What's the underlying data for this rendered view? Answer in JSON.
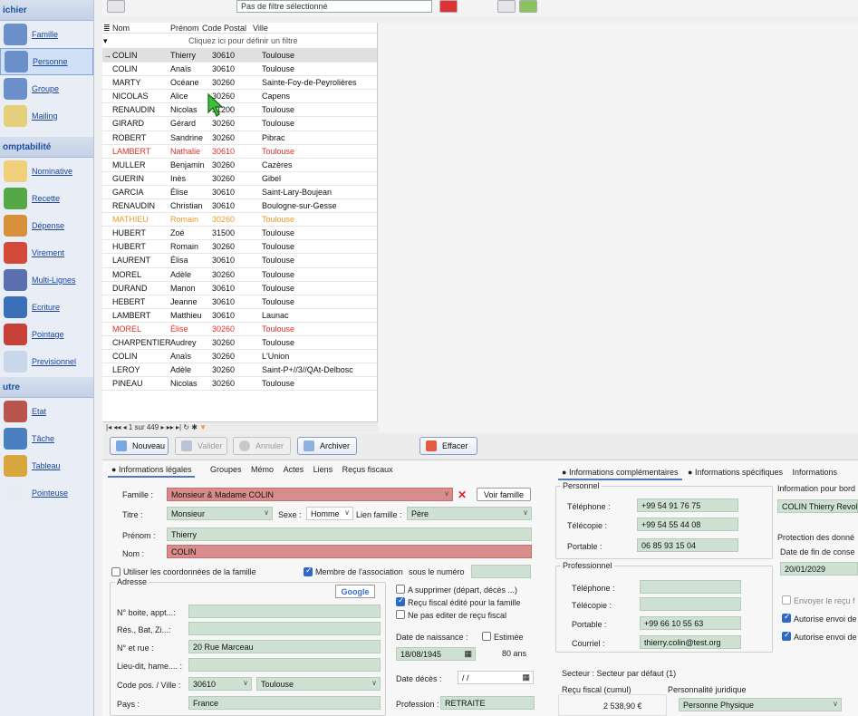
{
  "sidebar": {
    "header_top": "ichier",
    "items_top": [
      {
        "label": "Famille",
        "icon": "family-icon",
        "active": false,
        "color": "#6b8fc9"
      },
      {
        "label": "Personne",
        "icon": "person-icon",
        "active": true,
        "color": "#6b8fc9"
      },
      {
        "label": "Groupe",
        "icon": "group-icon",
        "active": false,
        "color": "#6b8fc9"
      },
      {
        "label": "Mailing",
        "icon": "envelope-icon",
        "active": false,
        "color": "#e6cf7a"
      }
    ],
    "header_compta": "omptabilité",
    "items_compta": [
      {
        "label": "Nominative",
        "icon": "document-icon",
        "color": "#f0d07a"
      },
      {
        "label": "Recette",
        "icon": "money-icon",
        "color": "#55a848"
      },
      {
        "label": "Dépense",
        "icon": "wallet-icon",
        "color": "#d8913a"
      },
      {
        "label": "Virement",
        "icon": "transfer-icon",
        "color": "#d34a3a"
      },
      {
        "label": "Multi-Lignes",
        "icon": "stack-icon",
        "color": "#5b6fae"
      },
      {
        "label": "Ecriture",
        "icon": "pen-icon",
        "color": "#3b6fb8"
      },
      {
        "label": "Pointage",
        "icon": "check-list-icon",
        "color": "#c8403a"
      },
      {
        "label": "Previsionnel",
        "icon": "gauge-icon",
        "color": "#c9d7ea"
      }
    ],
    "header_autre": "utre",
    "items_autre": [
      {
        "label": "Etat",
        "icon": "printer-icon",
        "color": "#b9554f"
      },
      {
        "label": "Tâche",
        "icon": "task-icon",
        "color": "#4b7fc0"
      },
      {
        "label": "Tableau",
        "icon": "folder-icon",
        "color": "#d7a63c"
      },
      {
        "label": "Pointeuse",
        "icon": "clock-icon",
        "color": "#e8ecf3"
      }
    ]
  },
  "toolbar": {
    "filter_value": "Pas de filtre sélectionné"
  },
  "grid": {
    "columns": [
      "Nom",
      "Prénom",
      "Code Postal",
      "Ville"
    ],
    "filter_hint": "Cliquez ici pour définir un filtre",
    "rows": [
      {
        "nom": "COLIN",
        "prenom": "Thierry",
        "cp": "30610",
        "ville": "Toulouse",
        "style": "sel"
      },
      {
        "nom": "COLIN",
        "prenom": "Anaïs",
        "cp": "30610",
        "ville": "Toulouse",
        "style": ""
      },
      {
        "nom": "MARTY",
        "prenom": "Océane",
        "cp": "30260",
        "ville": "Sainte-Foy-de-Peyrolières",
        "style": ""
      },
      {
        "nom": "NICOLAS",
        "prenom": "Alice",
        "cp": "30260",
        "ville": "Capens",
        "style": ""
      },
      {
        "nom": "RENAUDIN",
        "prenom": "Nicolas",
        "cp": "31200",
        "ville": "Toulouse",
        "style": ""
      },
      {
        "nom": "GIRARD",
        "prenom": "Gérard",
        "cp": "30260",
        "ville": "Toulouse",
        "style": ""
      },
      {
        "nom": "ROBERT",
        "prenom": "Sandrine",
        "cp": "30260",
        "ville": "Pibrac",
        "style": ""
      },
      {
        "nom": "LAMBERT",
        "prenom": "Nathalie",
        "cp": "30610",
        "ville": "Toulouse",
        "style": "red"
      },
      {
        "nom": "MULLER",
        "prenom": "Benjamin",
        "cp": "30260",
        "ville": "Cazères",
        "style": ""
      },
      {
        "nom": "GUERIN",
        "prenom": "Inès",
        "cp": "30260",
        "ville": "Gibel",
        "style": ""
      },
      {
        "nom": "GARCIA",
        "prenom": "Élise",
        "cp": "30610",
        "ville": "Saint-Lary-Boujean",
        "style": ""
      },
      {
        "nom": "RENAUDIN",
        "prenom": "Christian",
        "cp": "30610",
        "ville": "Boulogne-sur-Gesse",
        "style": ""
      },
      {
        "nom": "MATHIEU",
        "prenom": "Romain",
        "cp": "30260",
        "ville": "Toulouse",
        "style": "orange"
      },
      {
        "nom": "HUBERT",
        "prenom": "Zoé",
        "cp": "31500",
        "ville": "Toulouse",
        "style": ""
      },
      {
        "nom": "HUBERT",
        "prenom": "Romain",
        "cp": "30260",
        "ville": "Toulouse",
        "style": ""
      },
      {
        "nom": "LAURENT",
        "prenom": "Élisa",
        "cp": "30610",
        "ville": "Toulouse",
        "style": ""
      },
      {
        "nom": "MOREL",
        "prenom": "Adèle",
        "cp": "30260",
        "ville": "Toulouse",
        "style": ""
      },
      {
        "nom": "DURAND",
        "prenom": "Manon",
        "cp": "30610",
        "ville": "Toulouse",
        "style": ""
      },
      {
        "nom": "HEBERT",
        "prenom": "Jeanne",
        "cp": "30610",
        "ville": "Toulouse",
        "style": ""
      },
      {
        "nom": "LAMBERT",
        "prenom": "Matthieu",
        "cp": "30610",
        "ville": "Launac",
        "style": ""
      },
      {
        "nom": "MOREL",
        "prenom": "Élise",
        "cp": "30260",
        "ville": "Toulouse",
        "style": "red"
      },
      {
        "nom": "CHARPENTIER",
        "prenom": "Audrey",
        "cp": "30260",
        "ville": "Toulouse",
        "style": ""
      },
      {
        "nom": "COLIN",
        "prenom": "Anaïs",
        "cp": "30260",
        "ville": "L'Union",
        "style": ""
      },
      {
        "nom": "LEROY",
        "prenom": "Adèle",
        "cp": "30260",
        "ville": "Saint-P+//3//QAt-Delbosc",
        "style": ""
      },
      {
        "nom": "PINEAU",
        "prenom": "Nicolas",
        "cp": "30260",
        "ville": "Toulouse",
        "style": ""
      }
    ],
    "nav": "1 sur 449"
  },
  "actions": {
    "nouveau": "Nouveau",
    "valider": "Valider",
    "annuler": "Annuler",
    "archiver": "Archiver",
    "effacer": "Effacer"
  },
  "tabs_left": {
    "active": "Informations légales",
    "others": [
      "Groupes",
      "Mémo",
      "Actes",
      "Liens",
      "Reçus fiscaux"
    ]
  },
  "tabs_right": {
    "active": "Informations complémentaires",
    "other1": "Informations spécifiques",
    "other2": "Informations"
  },
  "legal": {
    "famille_label": "Famille :",
    "famille_value": "Monsieur & Madame COLIN",
    "voir_famille": "Voir famille",
    "titre_label": "Titre :",
    "titre_value": "Monsieur",
    "sexe_label": "Sexe :",
    "sexe_value": "Homme",
    "lien_label": "Lien famille :",
    "lien_value": "Père",
    "prenom_label": "Prénom :",
    "prenom_value": "Thierry",
    "nom_label": "Nom :",
    "nom_value": "COLIN",
    "use_family_coords": "Utiliser les coordonnées de la famille",
    "membre": "Membre de l'association",
    "sous_numero": "sous le numéro",
    "adresse_title": "Adresse",
    "boite_label": "N° boite, appt...:",
    "res_label": "Rés., Bat, Zi...:",
    "rue_label": "N° et rue :",
    "rue_value": "20 Rue Marceau",
    "lieu_label": "Lieu-dit, hame.... :",
    "cp_label": "Code pos. / Ville :",
    "cp_value": "30610",
    "ville_value": "Toulouse",
    "pays_label": "Pays :",
    "pays_value": "France",
    "a_supprimer": "A supprimer (départ, décès ...)",
    "recu_edite": "Reçu fiscal édité pour la famille",
    "ne_pas_editer": "Ne pas editer de reçu fiscal",
    "naissance_label": "Date de naissance :",
    "estimee": "Estimée",
    "naissance_value": "18/08/1945",
    "age": "80 ans",
    "deces_label": "Date décès :",
    "deces_value": "/ /",
    "profession_label": "Profession :",
    "profession_value": "RETRAITE",
    "google": "Google"
  },
  "comp": {
    "personnel": "Personnel",
    "tel_label": "Téléphone :",
    "tel_value": "+99 54 91 76 75",
    "fax_label": "Télécopie :",
    "fax_value": "+99 54 55 44 08",
    "port_label": "Portable :",
    "port_value": "06 85 93 15 04",
    "professionnel": "Professionnel",
    "ptel_label": "Téléphone :",
    "pfax_label": "Télécopie :",
    "pport_label": "Portable :",
    "pport_value": "+99 66 10 55 63",
    "mail_label": "Courriel :",
    "mail_value": "thierry.colin@test.org",
    "secteur": "Secteur : Secteur par défaut (1)",
    "recu_cumul_label": "Reçu fiscal (cumul)",
    "recu_cumul_value": "2 538,90 €",
    "perso_jur_label": "Personnalité juridique",
    "perso_jur_value": "Personne Physique"
  },
  "bord": {
    "title": "Information pour bord",
    "value": "COLIN Thierry Revolut",
    "protection": "Protection des donné",
    "date_fin_label": "Date de fin de conse",
    "date_fin_value": "20/01/2029",
    "envoyer": "Envoyer le reçu f",
    "autorise1": "Autorise envoi de",
    "autorise2": "Autorise envoi de"
  },
  "colors": {
    "accent": "#2f69c8",
    "required_red": "#d88c8c",
    "field_green": "#cfe1d2",
    "row_red": "#d9302b",
    "row_orange": "#ee9a2a"
  }
}
